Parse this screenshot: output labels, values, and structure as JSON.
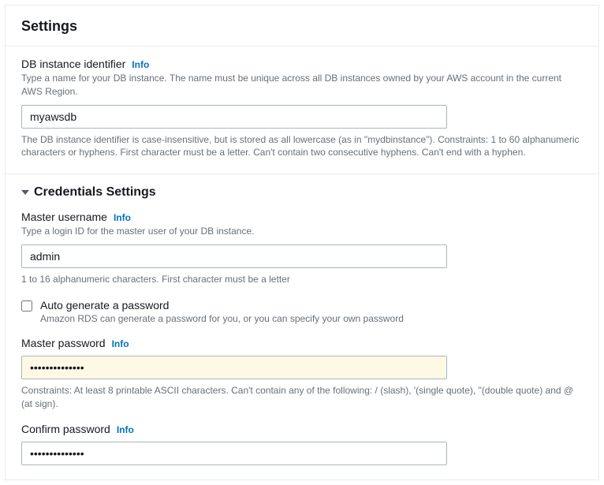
{
  "header": {
    "title": "Settings"
  },
  "dbIdentifier": {
    "label": "DB instance identifier",
    "info": "Info",
    "help": "Type a name for your DB instance. The name must be unique across all DB instances owned by your AWS account in the current AWS Region.",
    "value": "myawsdb",
    "constraint": "The DB instance identifier is case-insensitive, but is stored as all lowercase (as in \"mydbinstance\"). Constraints: 1 to 60 alphanumeric characters or hyphens. First character must be a letter. Can't contain two consecutive hyphens. Can't end with a hyphen."
  },
  "credentials": {
    "sectionTitle": "Credentials Settings",
    "username": {
      "label": "Master username",
      "info": "Info",
      "help": "Type a login ID for the master user of your DB instance.",
      "value": "admin",
      "constraint": "1 to 16 alphanumeric characters. First character must be a letter"
    },
    "autogen": {
      "label": "Auto generate a password",
      "help": "Amazon RDS can generate a password for you, or you can specify your own password"
    },
    "password": {
      "label": "Master password",
      "info": "Info",
      "value": "••••••••••••••",
      "constraint": "Constraints: At least 8 printable ASCII characters. Can't contain any of the following: / (slash), '(single quote), \"(double quote) and @ (at sign)."
    },
    "confirm": {
      "label": "Confirm password",
      "info": "Info",
      "value": "••••••••••••••"
    }
  }
}
